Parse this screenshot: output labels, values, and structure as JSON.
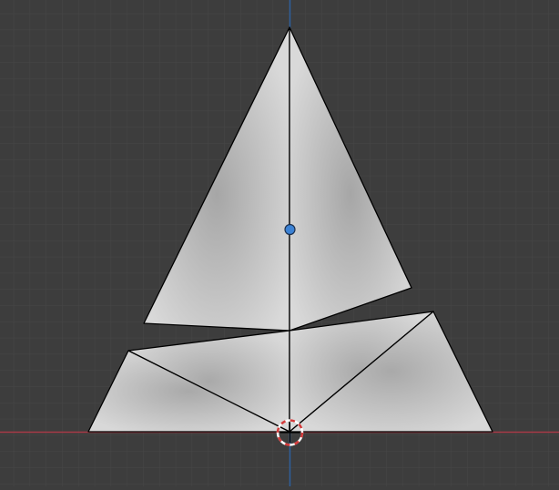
{
  "viewport": {
    "background": "#3d3d3d",
    "minor_grid_color": "#474747",
    "major_grid_color": "#575757",
    "x_axis_color": "#a83a47",
    "y_axis_color": "#2d5f9c"
  },
  "mesh": {
    "face_fill_light": "#d8d8d8",
    "face_fill_dark": "#a9a9a9",
    "edge_color": "#000000",
    "object_origin_color": "#3c82d4",
    "cursor_colors": [
      "#d43a3a",
      "#ffffff"
    ]
  },
  "icons": {
    "origin": "object-origin-dot-icon",
    "cursor": "3d-cursor-icon"
  }
}
